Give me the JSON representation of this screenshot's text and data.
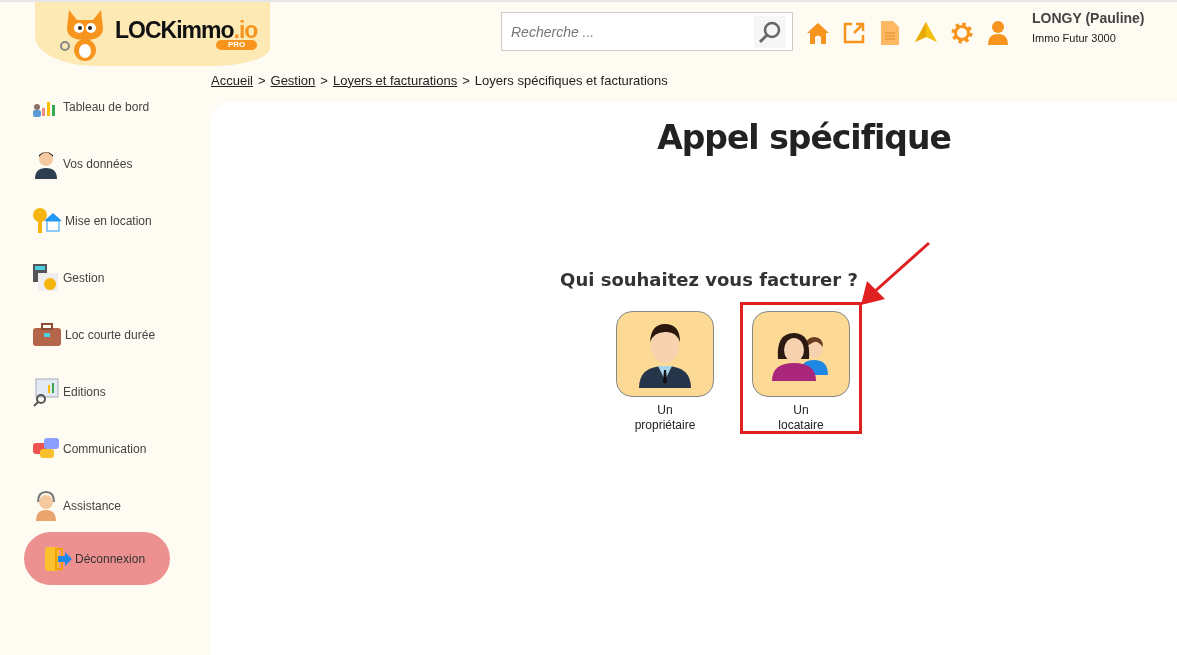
{
  "header": {
    "logo": {
      "name": "LOCKimmo",
      "suffix": ".io",
      "badge": "PRO"
    },
    "search": {
      "placeholder": "Recherche ..."
    },
    "user": {
      "name": "LONGY (Pauline)",
      "company": "Immo Futur 3000"
    }
  },
  "sidebar": {
    "items": [
      {
        "label": "Tableau de bord"
      },
      {
        "label": "Vos données"
      },
      {
        "label": "Mise en location"
      },
      {
        "label": "Gestion"
      },
      {
        "label": "Loc courte durée"
      },
      {
        "label": "Editions"
      },
      {
        "label": "Communication"
      },
      {
        "label": "Assistance"
      }
    ],
    "logout": {
      "label": "Déconnexion"
    }
  },
  "breadcrumb": [
    {
      "label": "Accueil",
      "link": true
    },
    {
      "label": "Gestion",
      "link": true
    },
    {
      "label": "Loyers et facturations",
      "link": true
    },
    {
      "label": "Loyers spécifiques et facturations",
      "link": false
    }
  ],
  "separator": ">",
  "title": "Appel spécifique",
  "question": "Qui souhaitez vous facturer ?",
  "options": [
    {
      "kind": "owner",
      "line1": "Un",
      "line2": "propriétaire",
      "highlighted": false
    },
    {
      "kind": "tenant",
      "line1": "Un",
      "line2": "locataire",
      "highlighted": true
    }
  ]
}
